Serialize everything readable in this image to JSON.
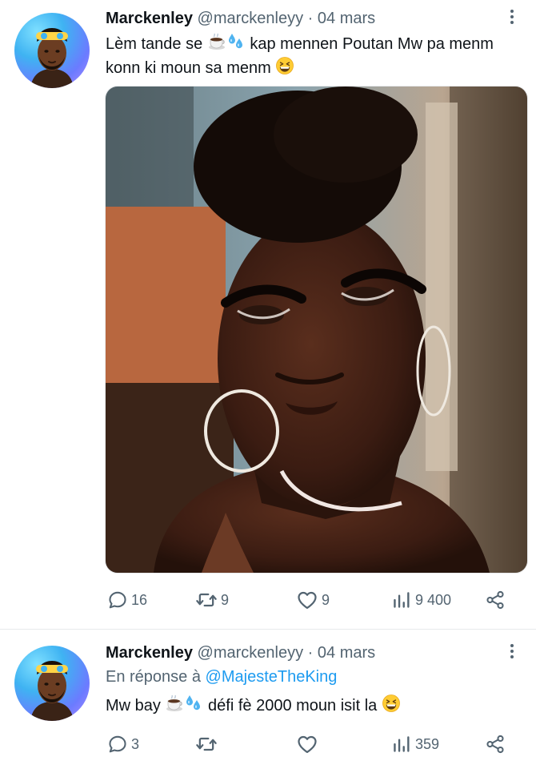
{
  "tweets": [
    {
      "author_name": "Marckenley",
      "handle": "@marckenleyy",
      "separator": "·",
      "date": "04 mars",
      "text_part1": "Lèm tande se",
      "text_part2": "kap mennen Poutan Mw pa menm konn ki moun sa menm",
      "emojis": [
        "hot-beverage",
        "sweat-droplets",
        "grinning-squinting-face"
      ],
      "has_image": true,
      "stats": {
        "replies": "16",
        "retweets": "9",
        "likes": "9",
        "views": "9 400"
      }
    },
    {
      "author_name": "Marckenley",
      "handle": "@marckenleyy",
      "separator": "·",
      "date": "04 mars",
      "reply_prefix": "En réponse à",
      "reply_mention": "@MajesteTheKing",
      "text_part1": "Mw bay",
      "text_part2": "défi fè 2000 moun isit la",
      "emojis": [
        "hot-beverage",
        "sweat-droplets",
        "grinning-squinting-face"
      ],
      "has_image": false,
      "stats": {
        "replies": "3",
        "retweets": "",
        "likes": "",
        "views": "359"
      }
    }
  ],
  "colors": {
    "text": "#0f1419",
    "secondary": "#536471",
    "link": "#1d9bf0",
    "divider": "#e7e9eb"
  }
}
